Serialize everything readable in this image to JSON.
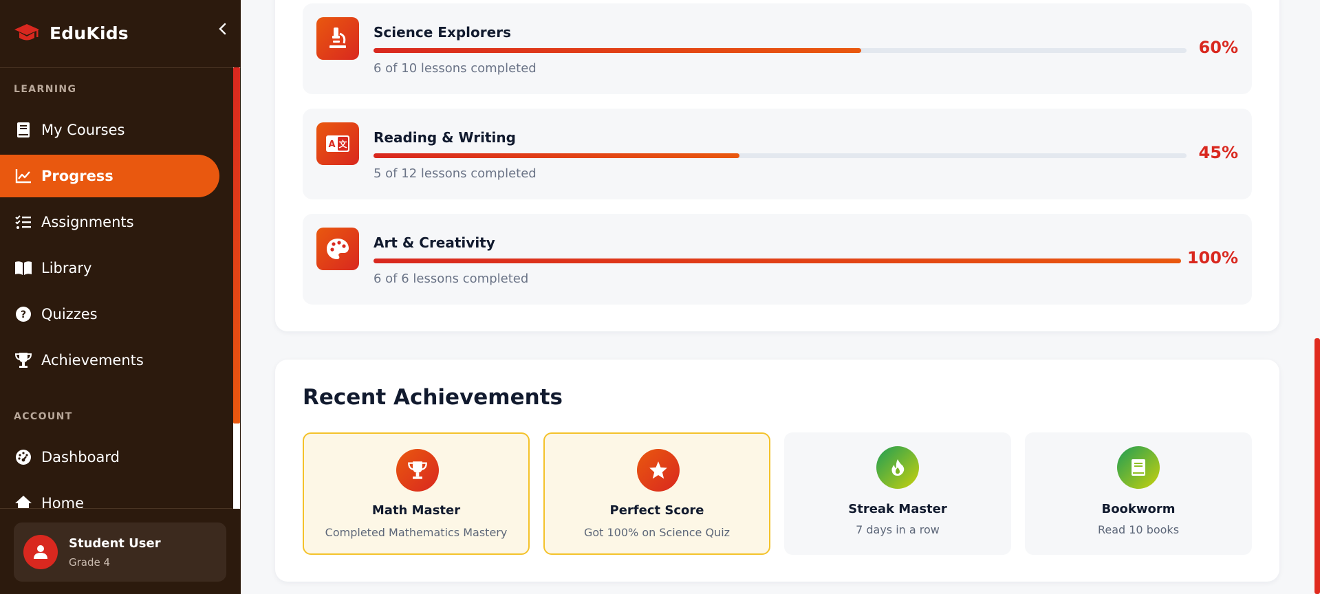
{
  "app": {
    "name": "EduKids"
  },
  "sidebar": {
    "collapse_icon": "chevron-left-icon",
    "sections": [
      {
        "label": "LEARNING"
      },
      {
        "label": "ACCOUNT"
      }
    ],
    "items": [
      {
        "label": "My Courses",
        "icon": "book-icon"
      },
      {
        "label": "Progress",
        "icon": "chart-line-icon",
        "active": true
      },
      {
        "label": "Assignments",
        "icon": "checklist-icon"
      },
      {
        "label": "Library",
        "icon": "open-book-icon"
      },
      {
        "label": "Quizzes",
        "icon": "question-circle-icon"
      },
      {
        "label": "Achievements",
        "icon": "trophy-icon"
      },
      {
        "label": "Dashboard",
        "icon": "gauge-icon"
      },
      {
        "label": "Home",
        "icon": "home-icon"
      }
    ],
    "user": {
      "name": "Student User",
      "grade": "Grade 4"
    }
  },
  "courses": [
    {
      "title": "Science Explorers",
      "subtitle": "6 of 10 lessons completed",
      "percent_label": "60%",
      "progress": 0.6,
      "icon": "microscope-icon"
    },
    {
      "title": "Reading & Writing",
      "subtitle": "5 of 12 lessons completed",
      "percent_label": "45%",
      "progress": 0.45,
      "icon": "language-icon"
    },
    {
      "title": "Art & Creativity",
      "subtitle": "6 of 6 lessons completed",
      "percent_label": "100%",
      "progress": 1.0,
      "icon": "palette-icon"
    }
  ],
  "achievements": {
    "title": "Recent Achievements",
    "items": [
      {
        "name": "Math Master",
        "description": "Completed Mathematics Mastery",
        "icon": "trophy-icon",
        "earned": true
      },
      {
        "name": "Perfect Score",
        "description": "Got 100% on Science Quiz",
        "icon": "star-icon",
        "earned": true
      },
      {
        "name": "Streak Master",
        "description": "7 days in a row",
        "icon": "flame-icon",
        "earned": false
      },
      {
        "name": "Bookworm",
        "description": "Read 10 books",
        "icon": "book-icon",
        "earned": false
      }
    ]
  },
  "colors": {
    "accent": "#e9580f",
    "accent_dark": "#d9281f",
    "sidebar_bg": "#2c1a0d",
    "gold": "#f4c22a"
  }
}
